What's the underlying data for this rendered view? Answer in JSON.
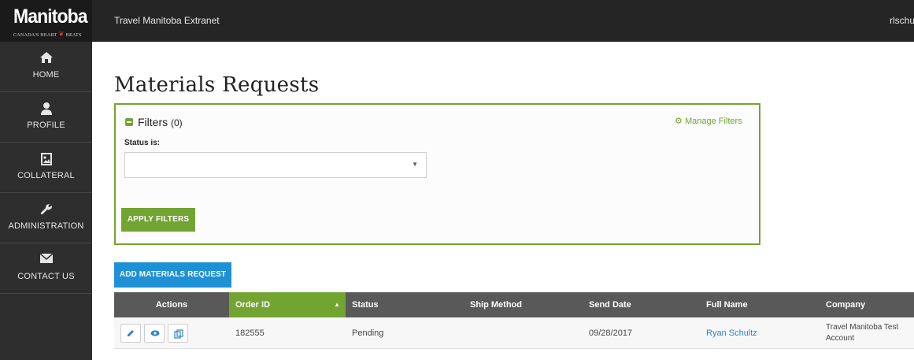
{
  "header": {
    "brand": "Manitoba",
    "tagline": "Canada's Heart Beats",
    "app_title": "Travel Manitoba Extranet",
    "user_name": "rlschu"
  },
  "sidebar": {
    "items": [
      {
        "label": "HOME",
        "icon": "home-icon"
      },
      {
        "label": "PROFILE",
        "icon": "user-icon"
      },
      {
        "label": "COLLATERAL",
        "icon": "image-icon"
      },
      {
        "label": "ADMINISTRATION",
        "icon": "wrench-icon"
      },
      {
        "label": "CONTACT US",
        "icon": "envelope-icon"
      }
    ]
  },
  "main": {
    "title": "Materials Requests",
    "filters": {
      "title": "Filters",
      "count": "(0)",
      "manage_label": "Manage Filters",
      "status_label": "Status is:",
      "status_value": "",
      "apply_label": "APPLY FILTERS"
    },
    "add_button_label": "ADD MATERIALS REQUEST"
  },
  "table": {
    "columns": [
      "Actions",
      "Order ID",
      "Status",
      "Ship Method",
      "Send Date",
      "Full Name",
      "Company"
    ],
    "sorted_column": "Order ID",
    "rows": [
      {
        "order_id": "182555",
        "status": "Pending",
        "ship_method": "",
        "send_date": "09/28/2017",
        "full_name": "Ryan Schultz",
        "company": "Travel Manitoba Test Account"
      }
    ]
  },
  "colors": {
    "accent_green": "#72a431",
    "accent_blue": "#1e90d6",
    "topbar": "#252525",
    "sidebar": "#2e2e2e",
    "table_header": "#595959"
  }
}
